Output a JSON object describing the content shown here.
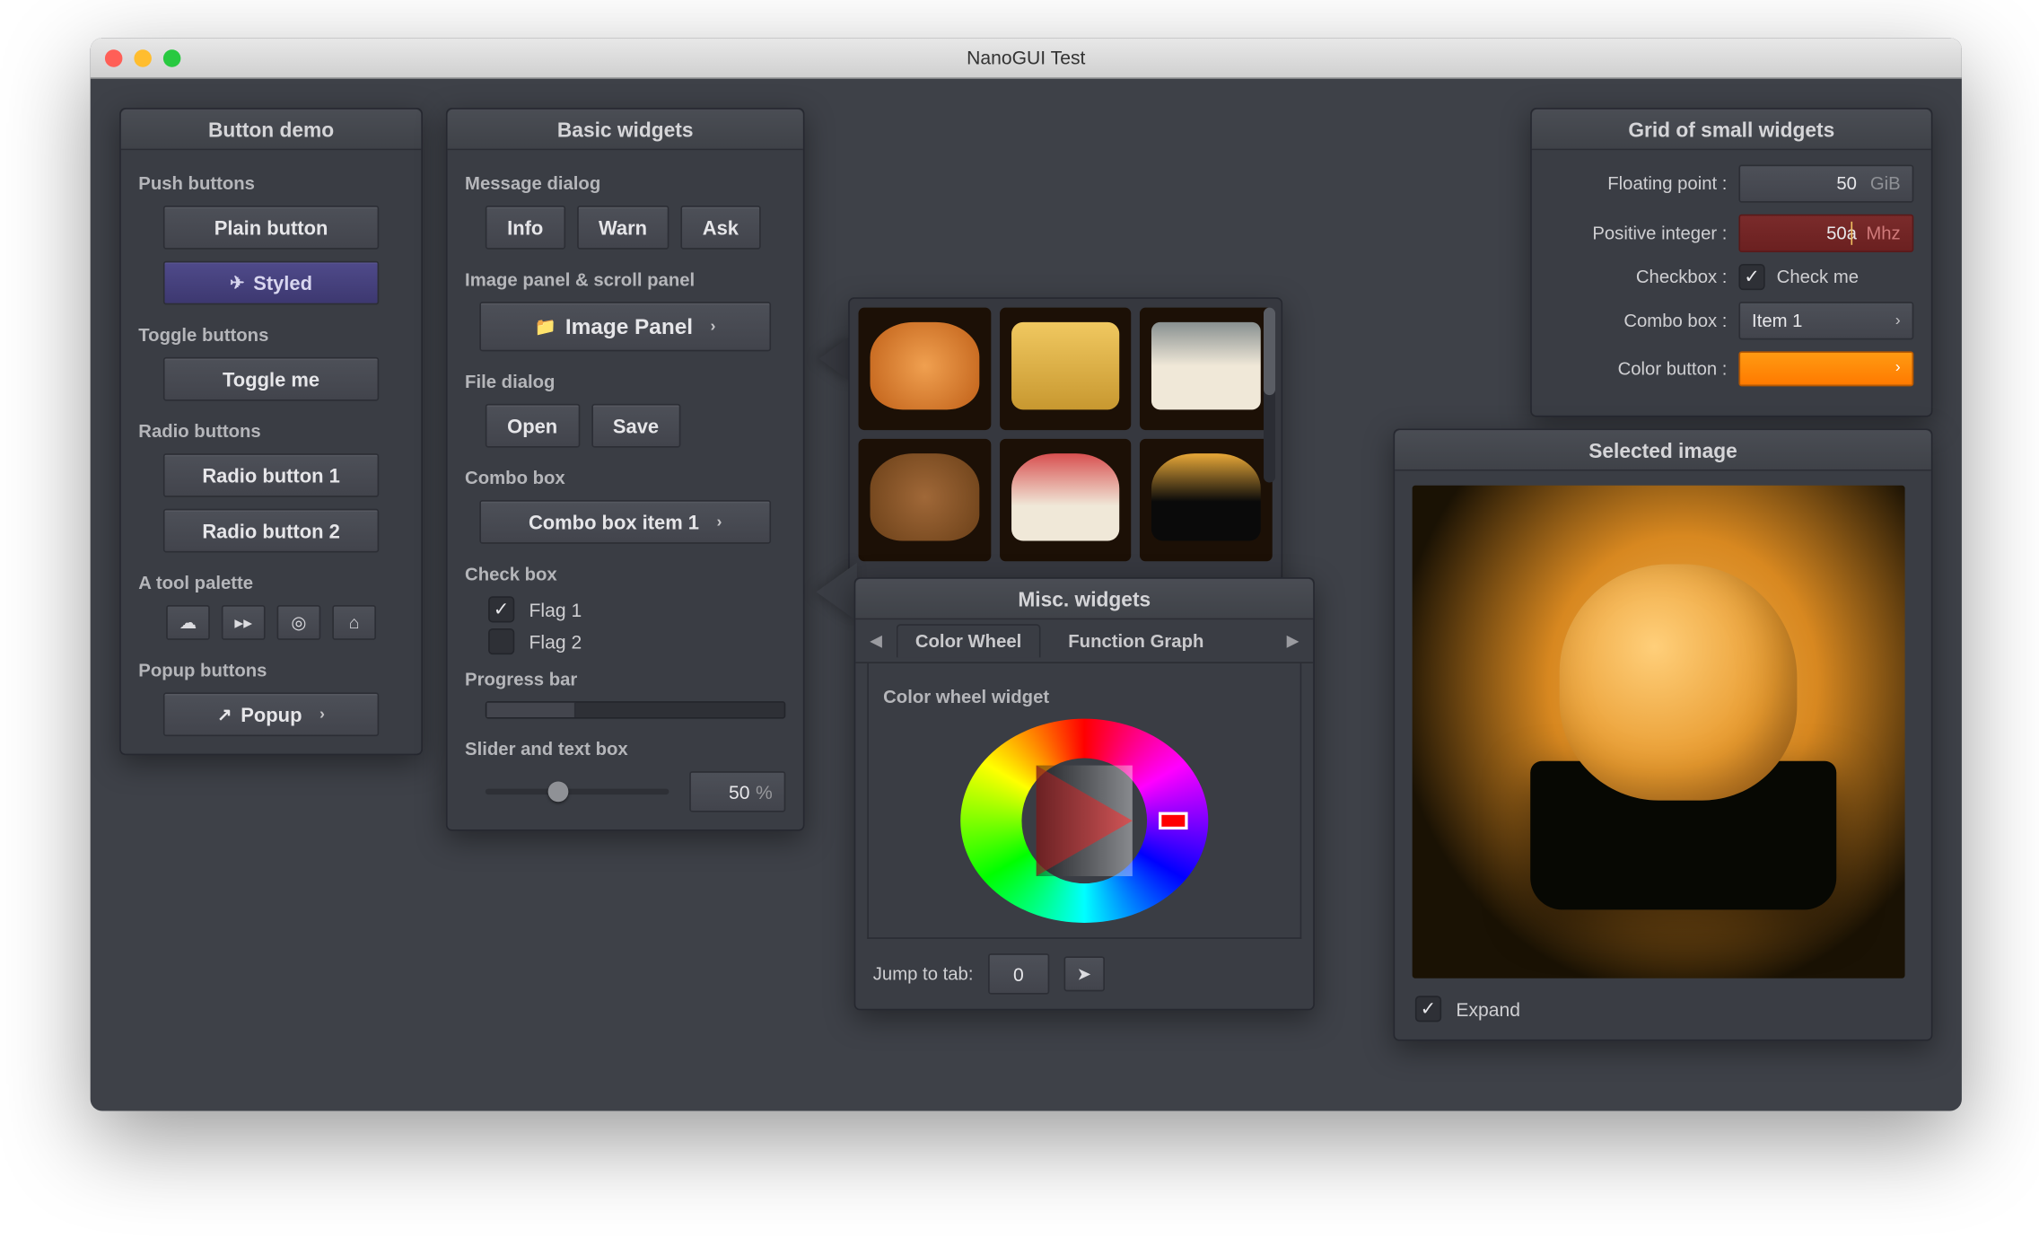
{
  "window": {
    "title": "NanoGUI Test"
  },
  "button_demo": {
    "title": "Button demo",
    "push_label": "Push buttons",
    "plain": "Plain button",
    "styled": "Styled",
    "toggle_label": "Toggle buttons",
    "toggle": "Toggle me",
    "radio_label": "Radio buttons",
    "radio1": "Radio button 1",
    "radio2": "Radio button 2",
    "tool_label": "A tool palette",
    "popup_label": "Popup buttons",
    "popup": "Popup"
  },
  "basic": {
    "title": "Basic widgets",
    "msg_label": "Message dialog",
    "info": "Info",
    "warn": "Warn",
    "ask": "Ask",
    "img_label": "Image panel & scroll panel",
    "img_btn": "Image Panel",
    "file_label": "File dialog",
    "open": "Open",
    "save": "Save",
    "combo_label": "Combo box",
    "combo_val": "Combo box item 1",
    "check_label": "Check box",
    "flag1": "Flag 1",
    "flag2": "Flag 2",
    "prog_label": "Progress bar",
    "slider_label": "Slider and text box",
    "slider_val": "50",
    "slider_unit": "%"
  },
  "misc": {
    "title": "Misc. widgets",
    "tab1": "Color Wheel",
    "tab2": "Function Graph",
    "wheel_label": "Color wheel widget",
    "jump_label": "Jump to tab:",
    "jump_val": "0"
  },
  "grid": {
    "title": "Grid of small widgets",
    "float_lbl": "Floating point :",
    "float_val": "50",
    "float_unit": "GiB",
    "int_lbl": "Positive integer :",
    "int_val": "50a",
    "int_unit": "Mhz",
    "check_lbl": "Checkbox :",
    "check_txt": "Check me",
    "combo_lbl": "Combo box :",
    "combo_val": "Item 1",
    "color_lbl": "Color button :",
    "color_val": "#ff8c00"
  },
  "selected": {
    "title": "Selected image",
    "expand": "Expand"
  }
}
